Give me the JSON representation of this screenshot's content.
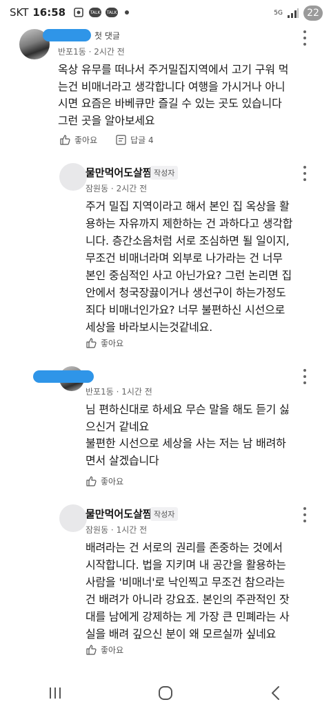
{
  "status_bar": {
    "carrier": "SKT",
    "time": "16:58",
    "talk1": "TALK",
    "talk2": "TALK",
    "network": "5G",
    "battery": "22"
  },
  "comments": [
    {
      "badge": "첫 댓글",
      "meta": "반포1동 · 2시간 전",
      "lines": [
        "옥상 유무를 떠나서 주거밀집지역에서 고기 구워 먹",
        "는건 비매너라고 생각합니다 여행을 가시거나 아니",
        "시면 요즘은 바베큐만 즐길 수 있는 곳도 있습니다",
        "그런 곳을 알아보세요"
      ],
      "like_label": "좋아요",
      "reply_label": "답글 4"
    },
    {
      "name": "물만먹어도살찜",
      "badge": "작성자",
      "meta": "잠원동 · 2시간 전",
      "lines": [
        "주거 밀집 지역이라고 해서 본인 집 옥상을 활",
        "용하는 자유까지 제한하는 건 과하다고 생각합",
        "니다. 층간소음처럼 서로 조심하면 될 일이지,",
        "무조건 비매너라며 외부로 나가라는 건 너무",
        "본인 중심적인 사고 아닌가요? 그런 논리면 집",
        "안에서 청국장끓이거나 생선구이 하는가정도",
        "죄다 비매너인가요? 너무 불편하신 시선으로",
        "세상을 바라보시는것같네요."
      ],
      "like_label": "좋아요"
    },
    {
      "meta": "반포1동 · 1시간 전",
      "lines": [
        "님 편하신대로 하세요 무슨 말을 해도 듣기 싫",
        "으신거 같네요",
        "불편한 시선으로 세상을 사는 저는 남 배려하",
        "면서 살겠습니다"
      ],
      "like_label": "좋아요"
    },
    {
      "name": "물만먹어도살찜",
      "badge": "작성자",
      "meta": "잠원동 · 1시간 전",
      "lines": [
        "배려라는 건 서로의 권리를 존중하는 것에서",
        "시작합니다. 법을 지키며 내 공간을 활용하는",
        "사람을 '비매너'로 낙인찍고 무조건 참으라는",
        "건 배려가 아니라 강요죠. 본인의 주관적인 잣",
        "대를 남에게 강제하는 게 가장 큰 민폐라는 사",
        "실을 배려 깊으신 분이 왜 모르실까 싶네요"
      ],
      "like_label": "좋아요"
    }
  ],
  "icons": {
    "like": "thumbs-up-icon",
    "reply": "reply-icon",
    "more": "more-vertical-icon",
    "nav": [
      "recent-apps-icon",
      "home-icon",
      "back-icon"
    ]
  }
}
